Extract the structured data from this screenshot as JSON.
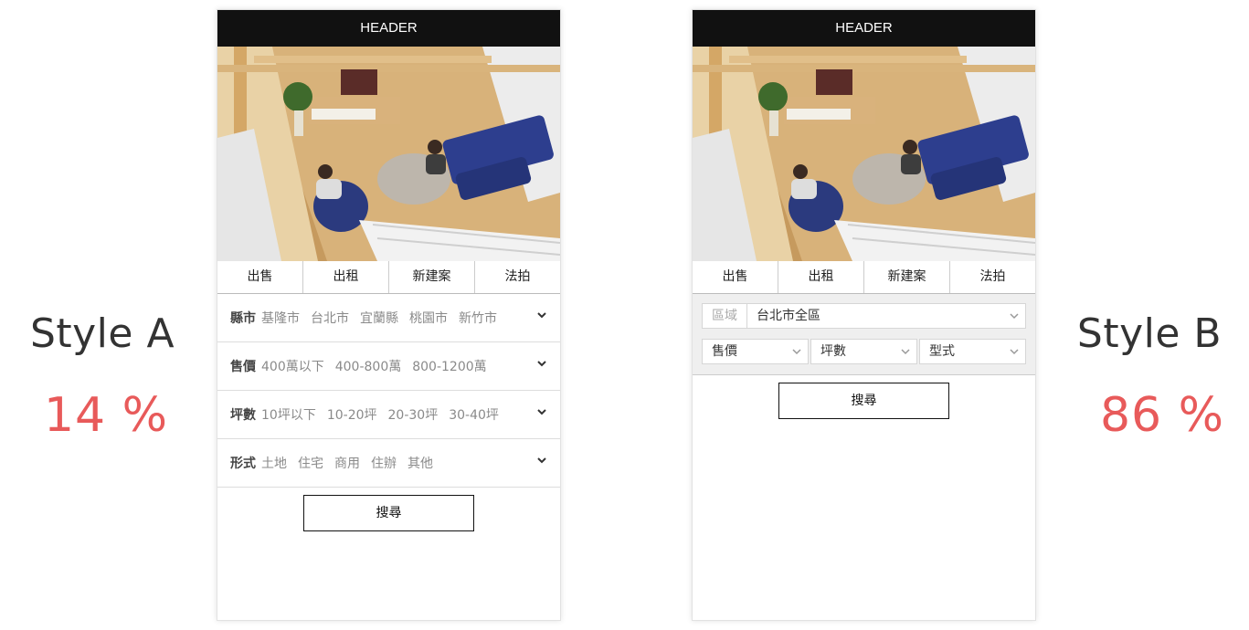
{
  "comparison": {
    "style_a": {
      "label": "Style A",
      "percent": "14 %"
    },
    "style_b": {
      "label": "Style B",
      "percent": "86 %"
    },
    "accent_color": "#e85a5a"
  },
  "phone": {
    "header": "HEADER",
    "tabs": [
      "出售",
      "出租",
      "新建案",
      "法拍"
    ],
    "search_label": "搜尋"
  },
  "style_a": {
    "filters": [
      {
        "label": "縣市",
        "options": [
          "基隆市",
          "台北市",
          "宜蘭縣",
          "桃園市",
          "新竹市"
        ]
      },
      {
        "label": "售價",
        "options": [
          "400萬以下",
          "400-800萬",
          "800-1200萬"
        ]
      },
      {
        "label": "坪數",
        "options": [
          "10坪以下",
          "10-20坪",
          "20-30坪",
          "30-40坪"
        ]
      },
      {
        "label": "形式",
        "options": [
          "土地",
          "住宅",
          "商用",
          "住辦",
          "其他"
        ]
      }
    ]
  },
  "style_b": {
    "region_label": "區域",
    "region_value": "台北市全區",
    "selects": [
      "售價",
      "坪數",
      "型式"
    ]
  }
}
